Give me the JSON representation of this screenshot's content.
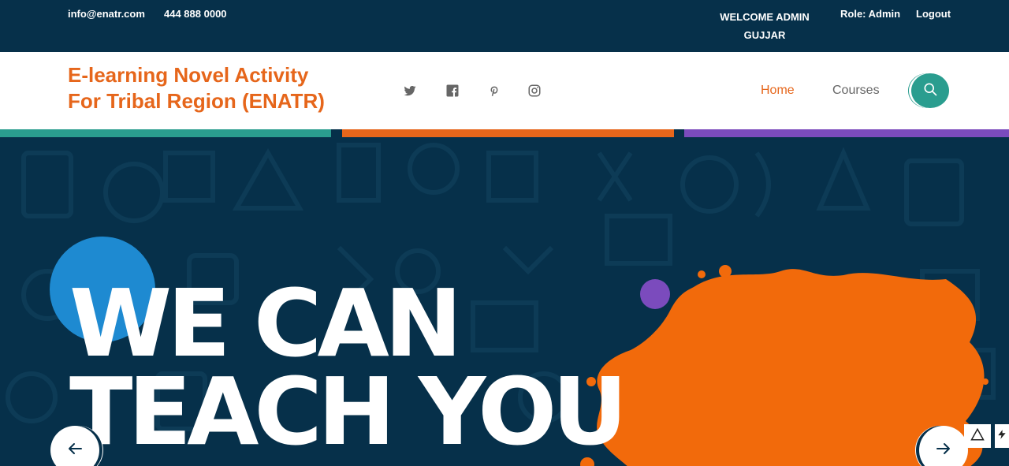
{
  "topbar": {
    "email": "info@enatr.com",
    "phone": "444 888 0000",
    "welcome": "WELCOME ADMIN GUJJAR",
    "role": "Role: Admin",
    "logout": "Logout"
  },
  "header": {
    "logo_line1": "E-learning Novel Activity",
    "logo_line2": "For Tribal Region (ENATR)",
    "social": [
      "twitter-icon",
      "facebook-icon",
      "pinterest-icon",
      "instagram-icon"
    ],
    "nav": {
      "home": "Home",
      "courses": "Courses"
    }
  },
  "hero": {
    "line1": "WE CAN",
    "line2": "TEACH YOU"
  },
  "colors": {
    "navy": "#06304a",
    "orange": "#e6661b",
    "teal": "#2a9d8f",
    "purple": "#7b4bbd",
    "blue": "#1e8ad1"
  }
}
